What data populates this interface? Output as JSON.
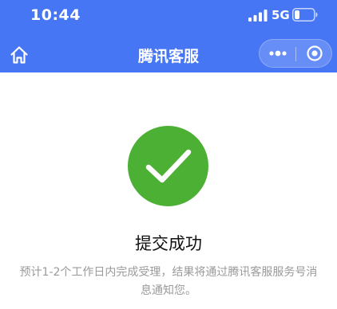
{
  "status_bar": {
    "time": "10:44",
    "network": "5G"
  },
  "nav": {
    "title": "腾讯客服",
    "home_icon": "home-icon",
    "more_icon": "more-dots-icon",
    "close_icon": "target-circle-icon"
  },
  "result": {
    "icon": "checkmark-circle-icon",
    "title": "提交成功",
    "description": "预计1-2个工作日内完成受理，结果将通过腾讯客服服务号消息通知您。"
  },
  "colors": {
    "header_bg": "#4676f4",
    "success_green": "#4cb035",
    "title_text": "#111111",
    "desc_text": "#9a9a9a"
  }
}
